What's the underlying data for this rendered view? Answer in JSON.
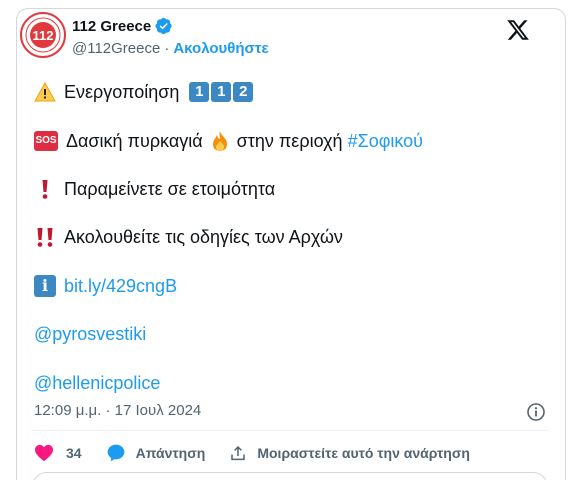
{
  "account": {
    "display_name": "112 Greece",
    "handle": "@112Greece",
    "separator": "·",
    "follow_label": "Ακολουθήστε",
    "avatar_text": "112"
  },
  "tweet": {
    "line1_text": "Ενεργοποίηση",
    "line1_keycaps": [
      "1",
      "1",
      "2"
    ],
    "line2_sos": "SOS",
    "line2_text_a": "Δασική πυρκαγιά",
    "line2_text_b": "στην περιοχή",
    "line2_hashtag": "#Σοφικού",
    "line3_text": "Παραμείνετε σε ετοιμότητα",
    "line4_text": "Ακολουθείτε τις οδηγίες των Αρχών",
    "line5_info": "i",
    "line5_link": "bit.ly/429cngB",
    "mention1": "@pyrosvestiki",
    "mention2": "@hellenicpolice"
  },
  "meta": {
    "timestamp": "12:09 μ.μ. · 17 Ιουλ 2024"
  },
  "actions": {
    "like_count": "34",
    "reply_label": "Απάντηση",
    "share_label": "Μοιραστείτε αυτό την ανάρτηση"
  },
  "colors": {
    "accent": "#1d9bf0",
    "like": "#f91880",
    "text": "#0f1419",
    "muted": "#536471"
  },
  "icons": [
    "verified-badge-icon",
    "x-logo-icon",
    "warning-icon",
    "fire-icon",
    "exclamation-icon",
    "double-exclamation-icon",
    "info-icon",
    "heart-icon",
    "reply-icon",
    "share-icon",
    "info-circle-icon"
  ]
}
